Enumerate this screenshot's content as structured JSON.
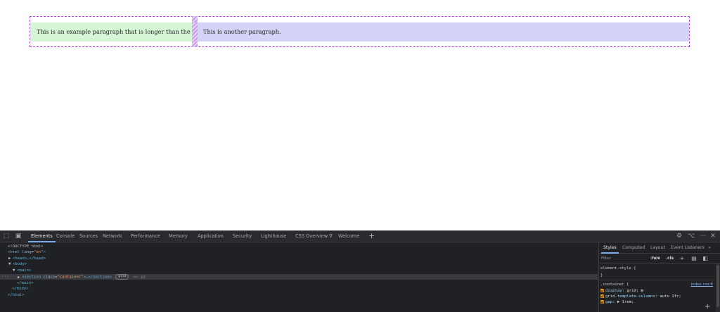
{
  "page": {
    "paragraph_1": "This is an example paragraph that is longer than the other one.",
    "paragraph_2": "This is another paragraph."
  },
  "devtools": {
    "tabs": [
      {
        "label": "Elements",
        "active": true
      },
      {
        "label": "Console"
      },
      {
        "label": "Sources"
      },
      {
        "label": "Network"
      },
      {
        "label": "Performance"
      },
      {
        "label": "Memory"
      },
      {
        "label": "Application"
      },
      {
        "label": "Security"
      },
      {
        "label": "Lighthouse"
      },
      {
        "label": "CSS Overview ∇"
      },
      {
        "label": "Welcome"
      }
    ],
    "dom": {
      "doctype": "<!DOCTYPE html>",
      "html_open_tag": "<html",
      "html_attr": "lang",
      "html_attr_val": "\"en\"",
      "head": "<head>…</head>",
      "body_open": "<body>",
      "main_open": "<main>",
      "section_tag": "<section",
      "section_attr": "class",
      "section_attr_val": "\"container\"",
      "section_rest": ">…</section>",
      "grid_badge": "grid",
      "eq_dollar": "== $0",
      "main_close": "</main>",
      "body_close": "</body>",
      "html_close": "</html>",
      "more_dots": "···"
    },
    "styles": {
      "tabs": [
        {
          "label": "Styles",
          "active": true
        },
        {
          "label": "Computed"
        },
        {
          "label": "Layout"
        },
        {
          "label": "Event Listeners"
        }
      ],
      "filter_placeholder": "Filter",
      "hov": ":hov",
      "cls": ".cls",
      "element_style": "element.style {",
      "close_brace": "}",
      "container_selector": ".container {",
      "source_link": "index.css:6",
      "declarations": [
        {
          "prop": "display",
          "value": "grid;"
        },
        {
          "prop": "grid-template-columns",
          "value": "auto 1fr;"
        },
        {
          "prop": "gap",
          "value": "▶ 1rem;"
        }
      ]
    },
    "colors": {
      "accent": "#7cacf8",
      "checkbox": "#f0a020",
      "cell_a_bg": "#d6f7d6",
      "cell_b_bg": "#d3d4f5"
    }
  }
}
